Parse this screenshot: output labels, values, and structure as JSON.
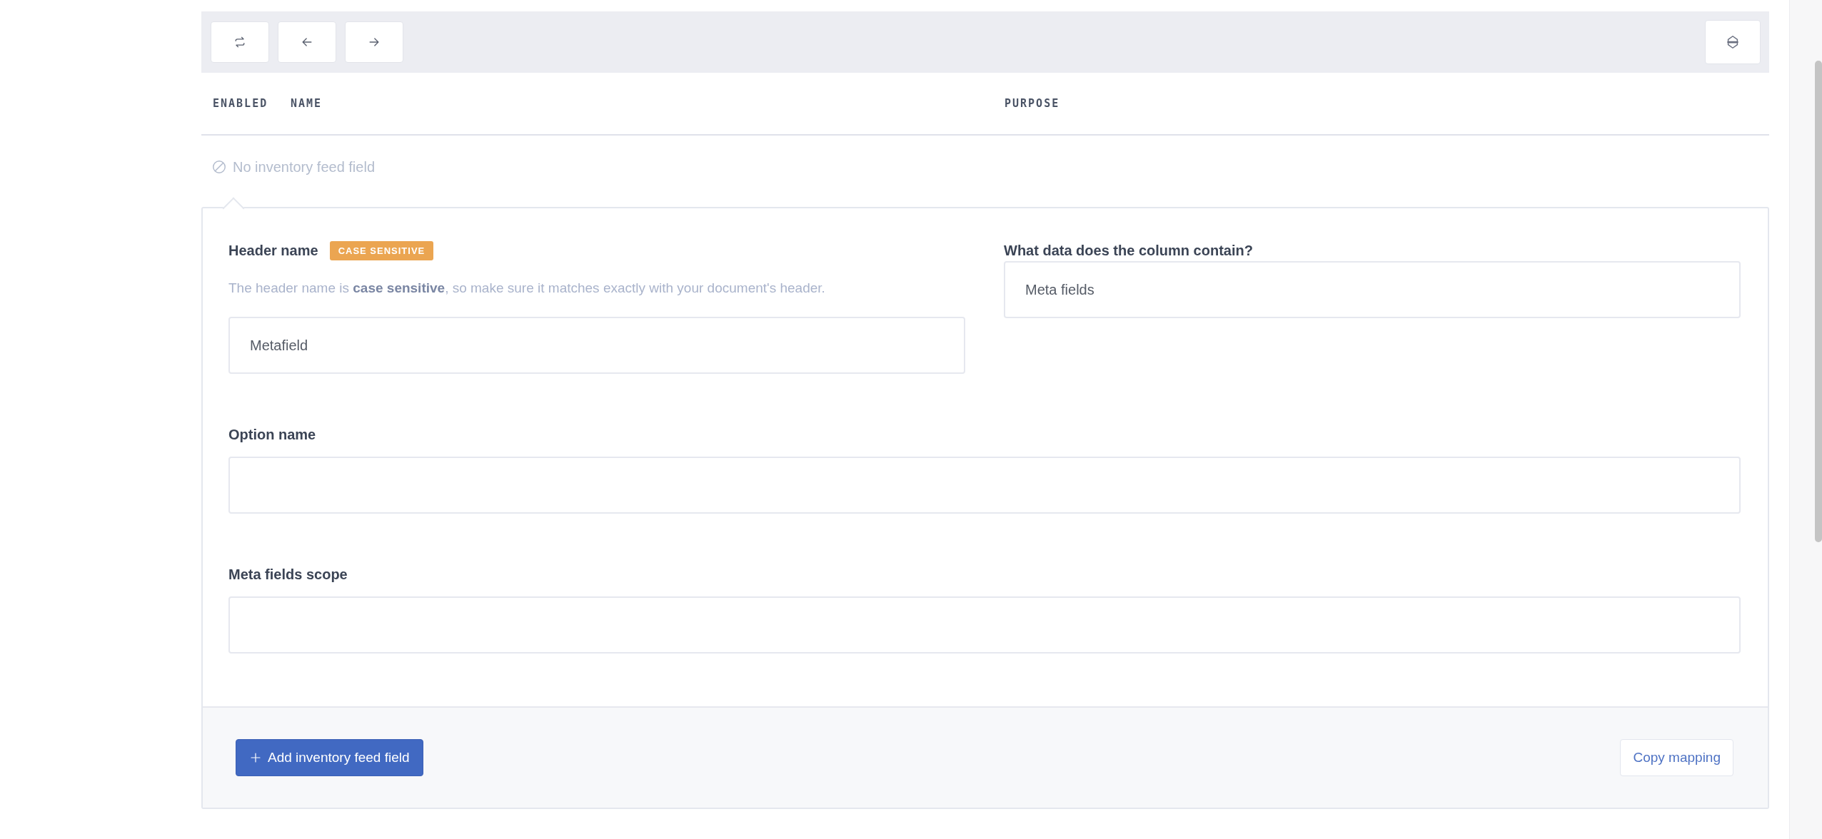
{
  "table": {
    "columns": [
      "ENABLED",
      "NAME",
      "PURPOSE"
    ],
    "empty_message": "No inventory feed field"
  },
  "editor": {
    "fields": [
      {
        "label": "Header name",
        "badge": "CASE SENSITIVE",
        "hint": "The header name is **case sensitive**, so make sure it matches exactly with your document's header.",
        "value": "Metafield"
      },
      {
        "label": "What data does the column contain?",
        "value": "Meta fields"
      },
      {
        "label": "Option name"
      },
      {
        "label": "Meta fields scope"
      }
    ]
  },
  "footer": {
    "add_button": "Add inventory feed field",
    "copy_button": "Copy mapping"
  }
}
